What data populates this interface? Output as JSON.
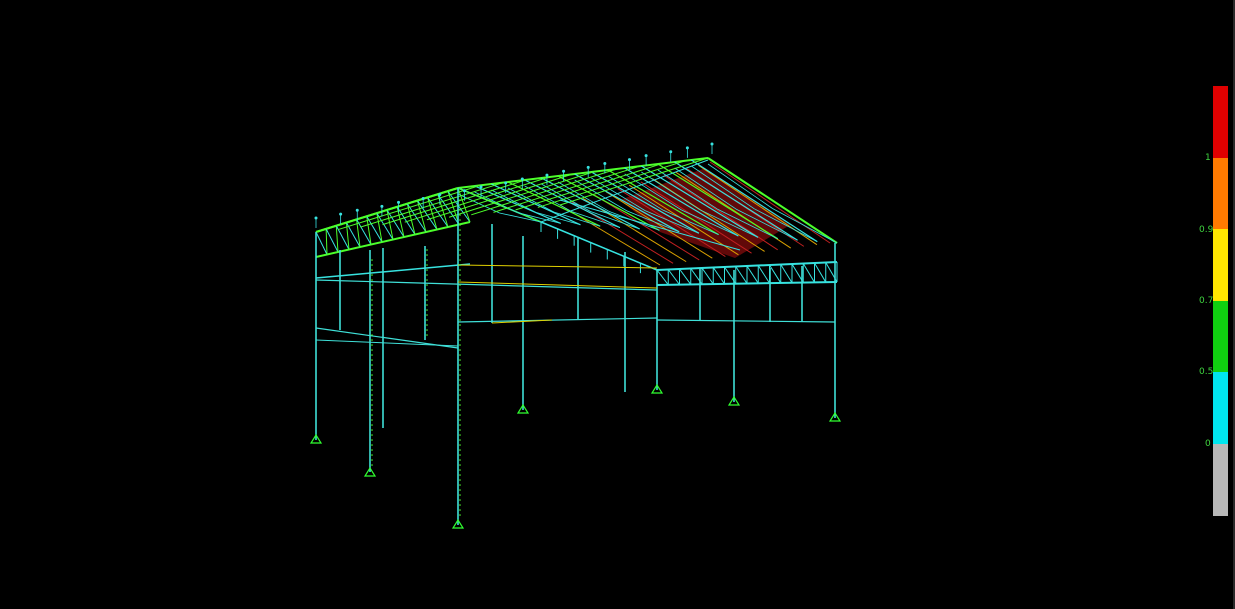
{
  "viewport": {
    "description_name": "steel-frame-3d-model"
  },
  "legend": {
    "colors": [
      "#e00000",
      "#ff7a00",
      "#ffe600",
      "#10d010",
      "#00e6ef",
      "#b8b8b8"
    ],
    "tick_labels": [
      "1",
      "0.9",
      "0.7",
      "0.5",
      "0"
    ]
  },
  "palette": {
    "background": "#000000",
    "column": "#3fe0d8",
    "truss_green": "#4cff2a",
    "truss_cyan": "#37e3e0",
    "roof_red": "#b01010",
    "beam_yellow": "#e0d000",
    "support": "#30ff30"
  }
}
